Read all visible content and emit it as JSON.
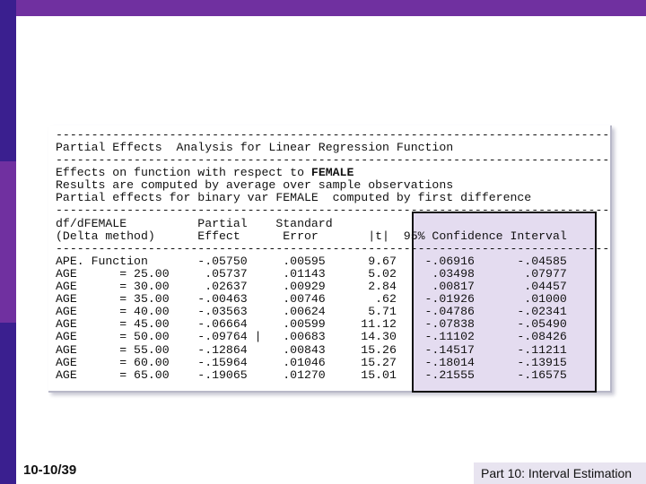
{
  "slide": {
    "number": "10-10/39",
    "footer": "Part 10: Interval Estimation"
  },
  "output": {
    "rule": "------------------------------------------------------------------------------",
    "title": "Partial Effects  Analysis for Linear Regression Function",
    "effects_line_prefix": "Effects on function with respect to ",
    "effects_var": "FEMALE",
    "results_line": "Results are computed by average over sample observations",
    "partial_line": "Partial effects for binary var FEMALE  computed by first difference",
    "header1": "df/dFEMALE          Partial    Standard",
    "header2": "(Delta method)      Effect      Error       |t|  95% Confidence Interval",
    "rows": [
      "APE. Function       -.05750     .00595      9.67    -.06916      -.04585",
      "AGE      = 25.00     .05737     .01143      5.02     .03498       .07977",
      "AGE      = 30.00     .02637     .00929      2.84     .00817       .04457",
      "AGE      = 35.00    -.00463     .00746       .62    -.01926       .01000",
      "AGE      = 40.00    -.03563     .00624      5.71    -.04786      -.02341",
      "AGE      = 45.00    -.06664     .00599     11.12    -.07838      -.05490",
      "AGE      = 50.00    -.09764 |   .00683     14.30    -.11102      -.08426",
      "AGE      = 55.00    -.12864     .00843     15.26    -.14517      -.11211",
      "AGE      = 60.00    -.15964     .01046     15.27    -.18014      -.13915",
      "AGE      = 65.00    -.19065     .01270     15.01    -.21555      -.16575"
    ]
  }
}
